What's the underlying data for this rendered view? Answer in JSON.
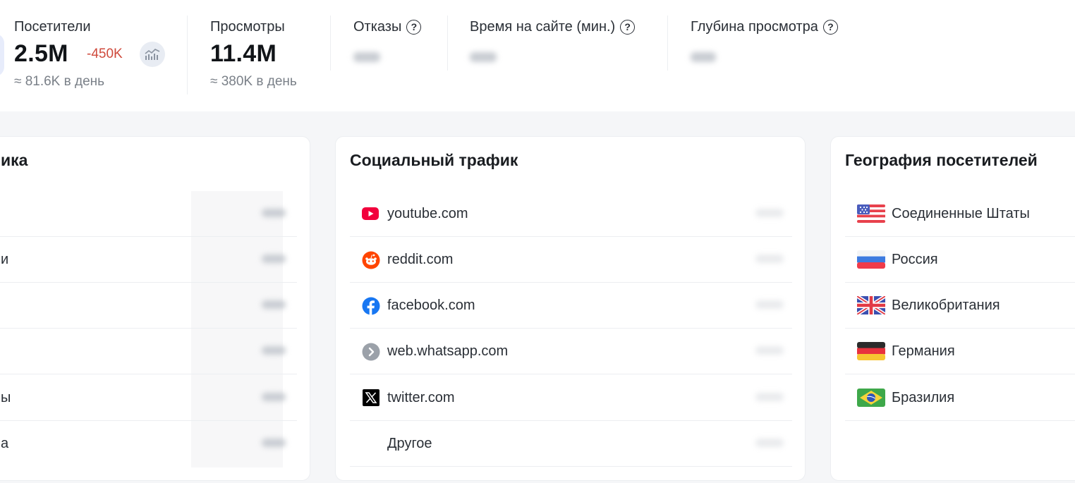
{
  "stats": {
    "visitors": {
      "label": "Посетители",
      "value": "2.5M",
      "delta": "-450K",
      "per_day": "≈ 81.6K в день",
      "chart_icon": "chart-icon"
    },
    "views": {
      "label": "Просмотры",
      "value": "11.4M",
      "per_day": "≈ 380K в день"
    },
    "bounces": {
      "label": "Отказы",
      "help": "?"
    },
    "time_on_site": {
      "label": "Время на сайте (мин.)",
      "help": "?"
    },
    "depth": {
      "label": "Глубина просмотра",
      "help": "?"
    }
  },
  "left_card": {
    "title_visible": "ика",
    "rows": [
      {
        "label": ""
      },
      {
        "label": "и"
      },
      {
        "label": ""
      },
      {
        "label": ""
      },
      {
        "label": "ы"
      },
      {
        "label": "а"
      }
    ]
  },
  "social": {
    "title": "Социальный трафик",
    "rows": [
      {
        "label": "youtube.com",
        "icon": "youtube-icon"
      },
      {
        "label": "reddit.com",
        "icon": "reddit-icon"
      },
      {
        "label": "facebook.com",
        "icon": "facebook-icon"
      },
      {
        "label": "web.whatsapp.com",
        "icon": "chevron-right-icon"
      },
      {
        "label": "twitter.com",
        "icon": "x-icon"
      },
      {
        "label": "Другое",
        "icon": ""
      }
    ]
  },
  "geo": {
    "title": "География посетителей",
    "rows": [
      {
        "label": "Соединенные Штаты",
        "icon": "flag-us-icon"
      },
      {
        "label": "Россия",
        "icon": "flag-ru-icon"
      },
      {
        "label": "Великобритания",
        "icon": "flag-uk-icon"
      },
      {
        "label": "Германия",
        "icon": "flag-de-icon"
      },
      {
        "label": "Бразилия",
        "icon": "flag-br-icon"
      }
    ]
  },
  "colors": {
    "delta_negative": "#cf4a3c",
    "youtube": "#f2003c",
    "reddit": "#ff4500",
    "facebook": "#1877f2"
  }
}
